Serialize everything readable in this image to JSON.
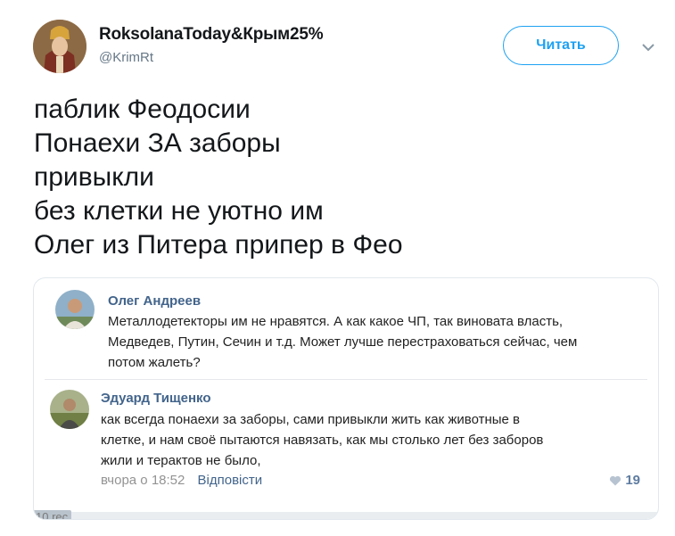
{
  "tweet": {
    "display_name": "RoksolanaToday&Крым25%",
    "handle": "@KrimRt",
    "follow_label": "Читать",
    "lines": [
      "паблик Феодосии",
      "Понаехи ЗА заборы",
      "привыкли",
      "без клетки не уютно им",
      "Олег из Питера припер в Фео"
    ]
  },
  "media": {
    "comments": [
      {
        "author": "Олег Андреев",
        "lines": [
          "Металлодетекторы им не нравятся. А как какое ЧП, так виновата власть,",
          "Медведев, Путин, Сечин и т.д. Может лучше перестраховаться сейчас, чем",
          "потом жалеть?"
        ]
      },
      {
        "author": "Эдуард Тищенко",
        "lines": [
          "как всегда понаехи за заборы, сами привыкли жить как животные в",
          "клетке, и нам своё пытаются навязать, как мы столько лет без заборов",
          "жили и терактов не было,"
        ],
        "time": "вчора о 18:52",
        "reply": "Відповісти",
        "likes": "19"
      }
    ],
    "cut_label": "10 rec"
  },
  "colors": {
    "accent": "#1da1f2",
    "vk_link": "#42648b",
    "meta_gray": "#939393"
  },
  "icons": [
    "user-avatar-icon",
    "chevron-down-icon",
    "commenter-avatar-icon",
    "heart-icon"
  ]
}
